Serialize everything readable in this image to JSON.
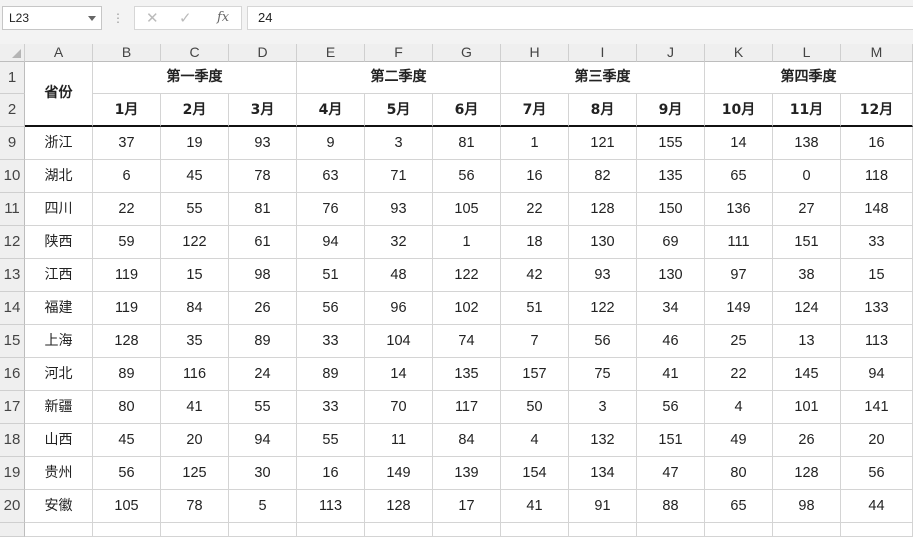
{
  "formula_bar": {
    "name_box": "L23",
    "formula": "24",
    "cancel_icon": "✕",
    "enter_icon": "✓",
    "function_icon": "fx"
  },
  "columns": [
    "A",
    "B",
    "C",
    "D",
    "E",
    "F",
    "G",
    "H",
    "I",
    "J",
    "K",
    "L",
    "M"
  ],
  "header": {
    "province_label": "省份",
    "quarters": [
      "第一季度",
      "第二季度",
      "第三季度",
      "第四季度"
    ],
    "months": [
      "1月",
      "2月",
      "3月",
      "4月",
      "5月",
      "6月",
      "7月",
      "8月",
      "9月",
      "10月",
      "11月",
      "12月"
    ]
  },
  "header_row_numbers": [
    "1",
    "2"
  ],
  "rows": [
    {
      "row": "9",
      "province": "浙江",
      "values": [
        "37",
        "19",
        "93",
        "9",
        "3",
        "81",
        "1",
        "121",
        "155",
        "14",
        "138",
        "16"
      ]
    },
    {
      "row": "10",
      "province": "湖北",
      "values": [
        "6",
        "45",
        "78",
        "63",
        "71",
        "56",
        "16",
        "82",
        "135",
        "65",
        "0",
        "118"
      ]
    },
    {
      "row": "11",
      "province": "四川",
      "values": [
        "22",
        "55",
        "81",
        "76",
        "93",
        "105",
        "22",
        "128",
        "150",
        "136",
        "27",
        "148"
      ]
    },
    {
      "row": "12",
      "province": "陕西",
      "values": [
        "59",
        "122",
        "61",
        "94",
        "32",
        "1",
        "18",
        "130",
        "69",
        "111",
        "151",
        "33"
      ]
    },
    {
      "row": "13",
      "province": "江西",
      "values": [
        "119",
        "15",
        "98",
        "51",
        "48",
        "122",
        "42",
        "93",
        "130",
        "97",
        "38",
        "15"
      ]
    },
    {
      "row": "14",
      "province": "福建",
      "values": [
        "119",
        "84",
        "26",
        "56",
        "96",
        "102",
        "51",
        "122",
        "34",
        "149",
        "124",
        "133"
      ]
    },
    {
      "row": "15",
      "province": "上海",
      "values": [
        "128",
        "35",
        "89",
        "33",
        "104",
        "74",
        "7",
        "56",
        "46",
        "25",
        "13",
        "113"
      ]
    },
    {
      "row": "16",
      "province": "河北",
      "values": [
        "89",
        "116",
        "24",
        "89",
        "14",
        "135",
        "157",
        "75",
        "41",
        "22",
        "145",
        "94"
      ]
    },
    {
      "row": "17",
      "province": "新疆",
      "values": [
        "80",
        "41",
        "55",
        "33",
        "70",
        "117",
        "50",
        "3",
        "56",
        "4",
        "101",
        "141"
      ]
    },
    {
      "row": "18",
      "province": "山西",
      "values": [
        "45",
        "20",
        "94",
        "55",
        "11",
        "84",
        "4",
        "132",
        "151",
        "49",
        "26",
        "20"
      ]
    },
    {
      "row": "19",
      "province": "贵州",
      "values": [
        "56",
        "125",
        "30",
        "16",
        "149",
        "139",
        "154",
        "134",
        "47",
        "80",
        "128",
        "56"
      ]
    },
    {
      "row": "20",
      "province": "安徽",
      "values": [
        "105",
        "78",
        "5",
        "113",
        "128",
        "17",
        "41",
        "91",
        "88",
        "65",
        "98",
        "44"
      ]
    }
  ]
}
